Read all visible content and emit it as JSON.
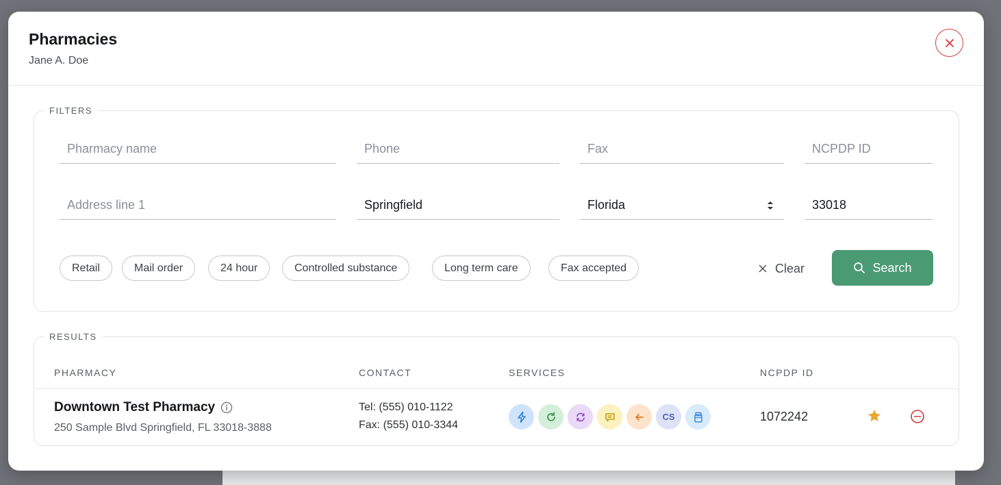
{
  "modal": {
    "title": "Pharmacies",
    "subtitle": "Jane A. Doe"
  },
  "filters": {
    "legend": "FILTERS",
    "pharmacy_name": {
      "placeholder": "Pharmacy name",
      "value": ""
    },
    "phone": {
      "placeholder": "Phone",
      "value": ""
    },
    "fax": {
      "placeholder": "Fax",
      "value": ""
    },
    "ncpdp_id": {
      "placeholder": "NCPDP ID",
      "value": ""
    },
    "address_line1": {
      "placeholder": "Address line 1",
      "value": ""
    },
    "city": {
      "value": "Springfield"
    },
    "state": {
      "value": "Florida"
    },
    "zip": {
      "value": "33018"
    },
    "chips": [
      "Retail",
      "Mail order",
      "24 hour",
      "Controlled substance",
      "Long term care",
      "Fax accepted"
    ],
    "clear_label": "Clear",
    "search_label": "Search",
    "accent_color": "#4a9a74"
  },
  "results": {
    "legend": "RESULTS",
    "columns": {
      "pharmacy": "PHARMACY",
      "contact": "CONTACT",
      "services": "SERVICES",
      "ncpdp": "NCPDP ID"
    },
    "rows": [
      {
        "name": "Downtown Test Pharmacy",
        "address": "250 Sample Blvd Springfield, FL 33018-3888",
        "tel": "Tel: (555) 010-1122",
        "fax": "Fax: (555) 010-3344",
        "services": [
          {
            "icon": "lightning-icon",
            "bg": "#cfe3fb",
            "fg": "#2f7fd8"
          },
          {
            "icon": "refresh-icon",
            "bg": "#d3efd9",
            "fg": "#3c9a56"
          },
          {
            "icon": "sync-icon",
            "bg": "#ead9f7",
            "fg": "#8c4cc8"
          },
          {
            "icon": "message-icon",
            "bg": "#fbf2bf",
            "fg": "#c79a12"
          },
          {
            "icon": "arrow-left-icon",
            "bg": "#fde3cc",
            "fg": "#e07a26"
          },
          {
            "icon": "cs-icon",
            "bg": "#dde2f7",
            "fg": "#5260b8",
            "label": "CS"
          },
          {
            "icon": "pill-bottle-icon",
            "bg": "#d8ebfb",
            "fg": "#3a8ad8"
          }
        ],
        "ncpdp": "1072242",
        "favorite_color": "#e8a72a",
        "remove_color": "#d23b3b"
      }
    ]
  }
}
